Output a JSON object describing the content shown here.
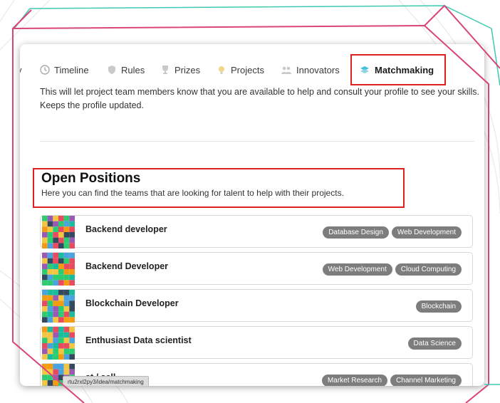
{
  "nav": {
    "cut_label": "v",
    "items": [
      {
        "label": "Timeline",
        "icon": "clock-icon"
      },
      {
        "label": "Rules",
        "icon": "shield-icon"
      },
      {
        "label": "Prizes",
        "icon": "trophy-icon"
      },
      {
        "label": "Projects",
        "icon": "bulb-icon"
      },
      {
        "label": "Innovators",
        "icon": "people-icon"
      },
      {
        "label": "Matchmaking",
        "icon": "handshake-icon",
        "active": true
      }
    ]
  },
  "intro_text": "This will let project team members know that you are available to help and consult your profile to see your skills. Keeps the profile updated.",
  "open_positions": {
    "title": "Open Positions",
    "subtitle": "Here you can find the teams that are looking for talent to help with their projects."
  },
  "positions": [
    {
      "title": "Backend developer",
      "tags": [
        "Database Design",
        "Web Development"
      ]
    },
    {
      "title": "Backend Developer",
      "tags": [
        "Web Development",
        "Cloud Computing"
      ]
    },
    {
      "title": "Blockchain Developer",
      "tags": [
        "Blockchain"
      ]
    },
    {
      "title": "Enthusiast Data scientist",
      "tags": [
        "Data Science"
      ]
    },
    {
      "title": "st / sell",
      "tags": [
        "Market Research",
        "Channel Marketing"
      ]
    }
  ],
  "status_url": "rtu2rxl2py3/idea/matchmaking",
  "colors": {
    "highlight": "#e02020",
    "tag_bg": "#7d7d7d",
    "frame_pink": "#d9457a",
    "frame_teal": "#3ec9b0"
  }
}
